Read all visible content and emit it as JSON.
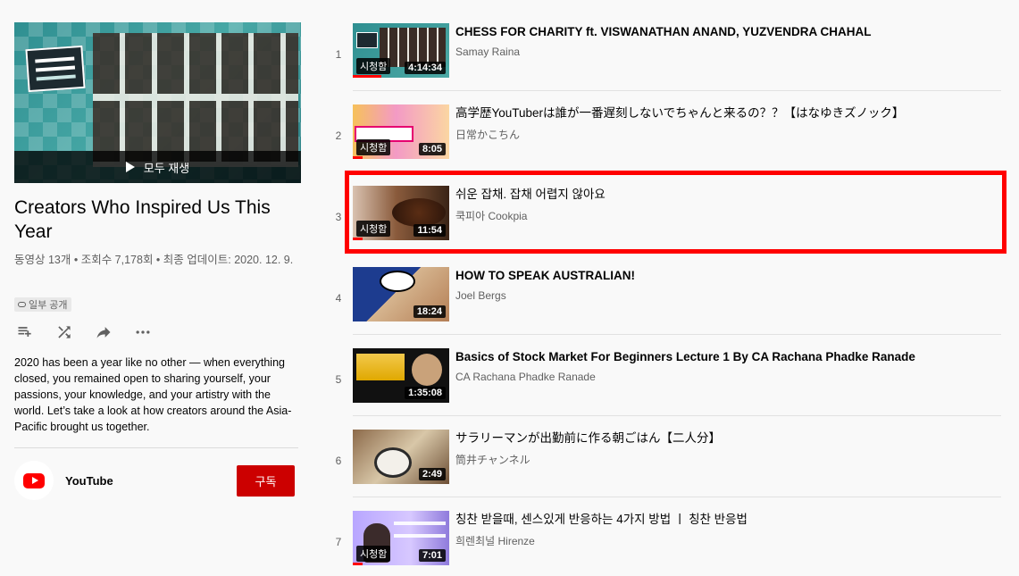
{
  "playlist": {
    "play_all_label": "모두 재생",
    "title": "Creators Who Inspired Us This Year",
    "stats": "동영상 13개 • 조회수 7,178회 • 최종 업데이트: 2020. 12. 9.",
    "privacy": "일부 공개",
    "description": "2020 has been a year like no other — when everything closed, you remained open to sharing yourself, your passions, your knowledge, and your artistry with the world. Let’s take a look at how creators around the Asia-Pacific brought us together.",
    "owner": {
      "name": "YouTube"
    },
    "subscribe_label": "구독"
  },
  "actions": [
    {
      "icon": "add-to-queue-icon"
    },
    {
      "icon": "shuffle-icon"
    },
    {
      "icon": "share-icon"
    },
    {
      "icon": "more-icon"
    }
  ],
  "videos": [
    {
      "index": "1",
      "title": "CHESS FOR CHARITY ft. VISWANATHAN ANAND, YUZVENDRA CHAHAL",
      "channel": "Samay Raina",
      "duration": "4:14:34",
      "watched": "시청함",
      "progress": 0.3
    },
    {
      "index": "2",
      "title": "高学歴YouTuberは誰が一番遅刻しないでちゃんと来るの？？【はなゆきズノック】",
      "channel": "日常かこちん",
      "duration": "8:05",
      "watched": "시청함",
      "progress": 0.1
    },
    {
      "index": "3",
      "title": "쉬운 잡채. 잡채 어렵지 않아요",
      "channel": "쿡피아 Cookpia",
      "duration": "11:54",
      "watched": "시청함",
      "progress": 0.1
    },
    {
      "index": "4",
      "title": "HOW TO SPEAK AUSTRALIAN!",
      "channel": "Joel Bergs",
      "duration": "18:24",
      "watched": "",
      "progress": 0
    },
    {
      "index": "5",
      "title": "Basics of Stock Market For Beginners Lecture 1 By CA Rachana Phadke Ranade",
      "channel": "CA Rachana Phadke Ranade",
      "duration": "1:35:08",
      "watched": "",
      "progress": 0
    },
    {
      "index": "6",
      "title": "サラリーマンが出勤前に作る朝ごはん【二人分】",
      "channel": "筒井チャンネル",
      "duration": "2:49",
      "watched": "",
      "progress": 0
    },
    {
      "index": "7",
      "title": "칭찬 받을때, 센스있게 반응하는 4가지 방법 ㅣ 칭찬 반응법",
      "channel": "희렌최널 Hirenze",
      "duration": "7:01",
      "watched": "시청함",
      "progress": 0.1
    }
  ],
  "colors": {
    "accent": "#ff0000",
    "subscribe": "#cc0000",
    "highlight": "#ff0000"
  }
}
